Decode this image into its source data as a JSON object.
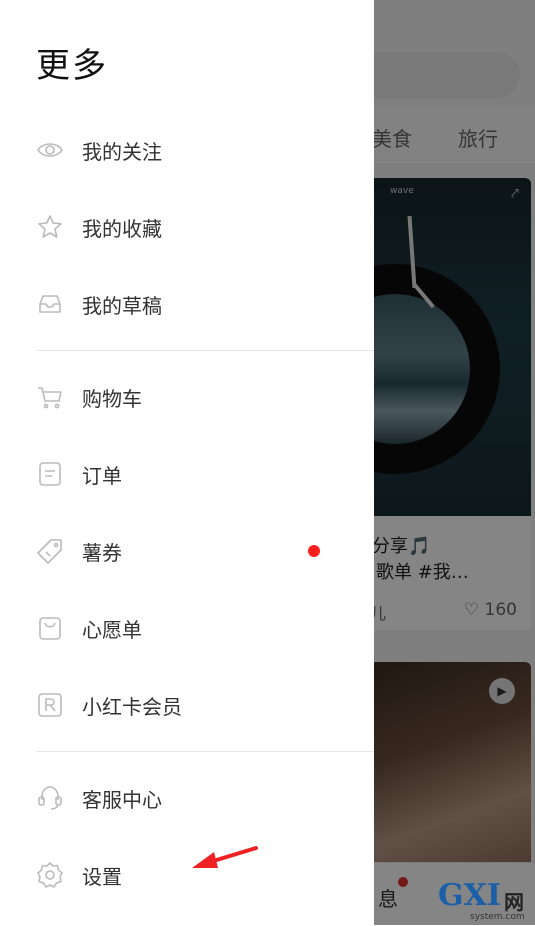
{
  "background": {
    "tabs": [
      "美食",
      "旅行"
    ],
    "card1": {
      "brand_text": "wave",
      "title": "分享🎵",
      "subtitle": "歌单 #我…",
      "author": "儿",
      "likes": "160"
    },
    "bottom_nav": {
      "message_label": "息"
    },
    "watermark": {
      "text": "GXI",
      "wang": "网",
      "sub": "system.com"
    }
  },
  "drawer": {
    "title": "更多",
    "items": [
      {
        "label": "我的关注",
        "icon": "eye-icon"
      },
      {
        "label": "我的收藏",
        "icon": "star-icon"
      },
      {
        "label": "我的草稿",
        "icon": "inbox-icon"
      },
      {
        "label": "购物车",
        "icon": "cart-icon"
      },
      {
        "label": "订单",
        "icon": "order-icon"
      },
      {
        "label": "薯券",
        "icon": "coupon-tag-icon",
        "badge_color": "#ff1d1d"
      },
      {
        "label": "心愿单",
        "icon": "wishlist-bag-icon"
      },
      {
        "label": "小红卡会员",
        "icon": "member-card-icon"
      },
      {
        "label": "客服中心",
        "icon": "headset-icon"
      },
      {
        "label": "设置",
        "icon": "gear-icon"
      }
    ]
  },
  "annotation": {
    "arrow_color": "#ee2222"
  }
}
